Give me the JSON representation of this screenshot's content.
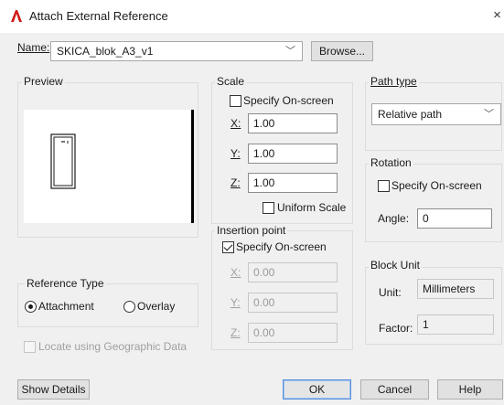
{
  "window": {
    "title": "Attach External Reference",
    "close_glyph": "×"
  },
  "name_row": {
    "label": "Name:",
    "value": "SKICA_blok_A3_v1",
    "browse": "Browse..."
  },
  "preview": {
    "title": "Preview"
  },
  "reference_type": {
    "title": "Reference Type",
    "attachment": "Attachment",
    "overlay": "Overlay",
    "selected": "Attachment"
  },
  "locate": {
    "label": "Locate using Geographic Data",
    "checked": false,
    "enabled": false
  },
  "scale": {
    "title": "Scale",
    "specify": "Specify On-screen",
    "specify_checked": false,
    "x_label": "X:",
    "x": "1.00",
    "y_label": "Y:",
    "y": "1.00",
    "z_label": "Z:",
    "z": "1.00",
    "uniform": "Uniform Scale",
    "uniform_checked": false
  },
  "insertion": {
    "title": "Insertion point",
    "specify": "Specify On-screen",
    "specify_checked": true,
    "x_label": "X:",
    "x": "0.00",
    "y_label": "Y:",
    "y": "0.00",
    "z_label": "Z:",
    "z": "0.00"
  },
  "path_type": {
    "title": "Path type",
    "value": "Relative path"
  },
  "rotation": {
    "title": "Rotation",
    "specify": "Specify On-screen",
    "specify_checked": false,
    "angle_label": "Angle:",
    "angle": "0"
  },
  "block_unit": {
    "title": "Block Unit",
    "unit_label": "Unit:",
    "unit": "Millimeters",
    "factor_label": "Factor:",
    "factor": "1"
  },
  "buttons": {
    "show_details": "Show Details",
    "ok": "OK",
    "cancel": "Cancel",
    "help": "Help"
  },
  "icons": {
    "app": "autocad-logo-icon",
    "close": "close-icon",
    "dropdown": "chevron-down-icon"
  }
}
